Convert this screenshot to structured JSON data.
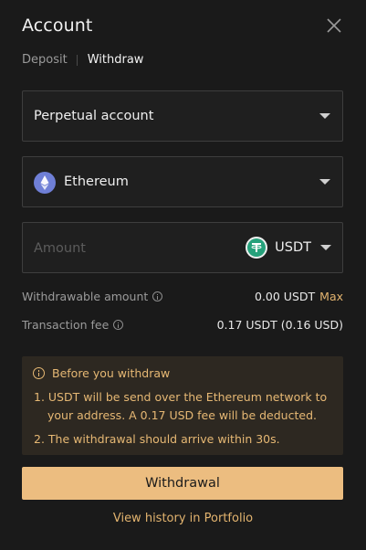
{
  "header": {
    "title": "Account"
  },
  "tabs": [
    {
      "label": "Deposit"
    },
    {
      "label": "Withdraw"
    }
  ],
  "account_select": {
    "value": "Perpetual account"
  },
  "network_select": {
    "value": "Ethereum",
    "icon": "ethereum-icon"
  },
  "amount": {
    "placeholder": "Amount",
    "value": "",
    "token": "USDT",
    "token_icon": "usdt-icon"
  },
  "withdrawable": {
    "label": "Withdrawable amount",
    "value": "0.00 USDT",
    "max_label": "Max"
  },
  "fee": {
    "label": "Transaction fee",
    "value": "0.17 USDT (0.16 USD)"
  },
  "notice": {
    "title": "Before you withdraw",
    "line1a": "1. USDT will be send over the Ethereum network to",
    "line1b": "your address. A 0.17 USD fee will be deducted.",
    "line2": "2. The withdrawal should arrive within 30s."
  },
  "withdraw_button": {
    "label": "Withdrawal"
  },
  "history_link": {
    "label": "View history in Portfolio"
  },
  "colors": {
    "background": "#1a1a1a",
    "accent": "#ecbd80",
    "notice_bg": "#2d2821",
    "notice_text": "#e6b874"
  }
}
